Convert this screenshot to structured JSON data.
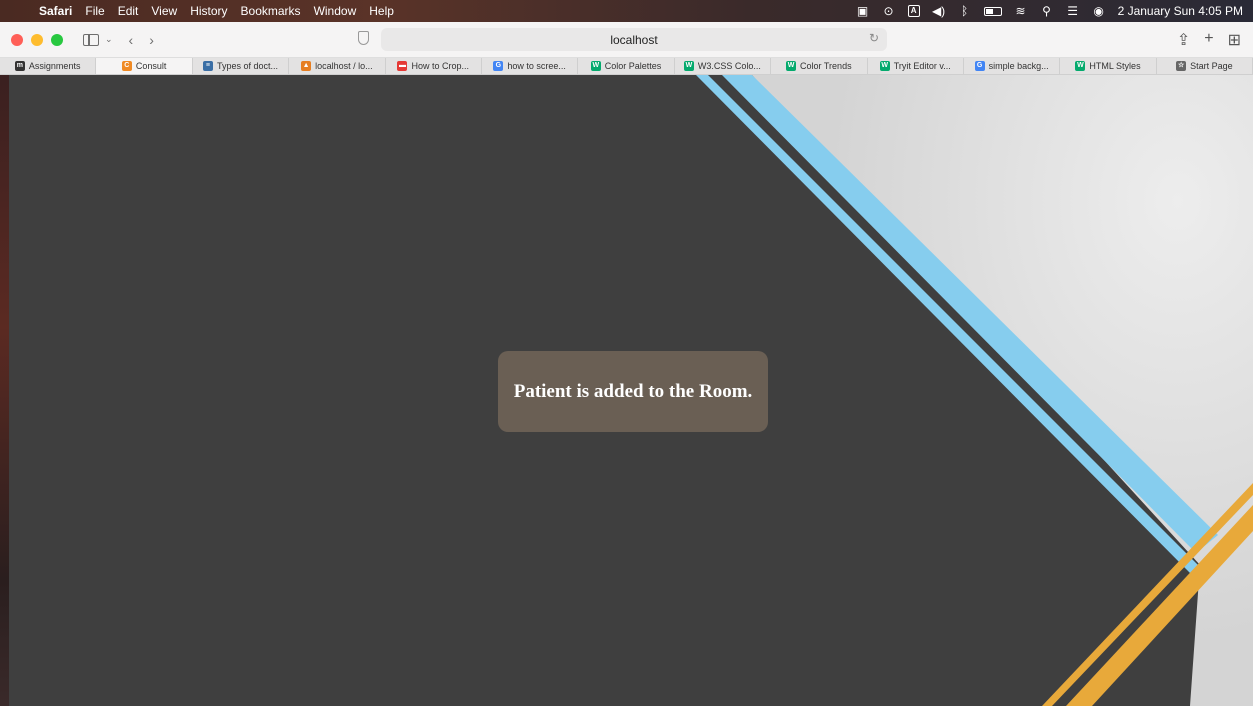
{
  "menubar": {
    "apple_icon": "apple-icon",
    "app_name": "Safari",
    "menus": [
      "File",
      "Edit",
      "View",
      "History",
      "Bookmarks",
      "Window",
      "Help"
    ],
    "status_box_letter": "A",
    "datetime": "2 January Sun  4:05 PM"
  },
  "toolbar": {
    "address": "localhost"
  },
  "tabs": [
    {
      "label": "Assignments",
      "favicon": "m",
      "color": "#333333"
    },
    {
      "label": "Consult",
      "favicon": "C",
      "color": "#f08a24"
    },
    {
      "label": "Types of doct...",
      "favicon": "≡",
      "color": "#3a6ea5"
    },
    {
      "label": "localhost / lo...",
      "favicon": "▲",
      "color": "#e67e22"
    },
    {
      "label": "How to Crop...",
      "favicon": "▬",
      "color": "#e53935"
    },
    {
      "label": "how to scree...",
      "favicon": "G",
      "color": "#4285f4"
    },
    {
      "label": "Color Palettes",
      "favicon": "W",
      "color": "#04aa6d"
    },
    {
      "label": "W3.CSS Colo...",
      "favicon": "W",
      "color": "#04aa6d"
    },
    {
      "label": "Color Trends",
      "favicon": "W",
      "color": "#04aa6d"
    },
    {
      "label": "Tryit Editor v...",
      "favicon": "W",
      "color": "#04aa6d"
    },
    {
      "label": "simple backg...",
      "favicon": "G",
      "color": "#4285f4"
    },
    {
      "label": "HTML Styles",
      "favicon": "W",
      "color": "#04aa6d"
    },
    {
      "label": "Start Page",
      "favicon": "☆",
      "color": "#666666"
    }
  ],
  "toast": {
    "message": "Patient is added to the Room."
  },
  "colors": {
    "background_dark": "#3f3f3f",
    "background_light": "#e6e6e6",
    "stripe_blue": "#86cdee",
    "stripe_orange": "#e8a93a",
    "toast_bg": "#6a5f54"
  }
}
